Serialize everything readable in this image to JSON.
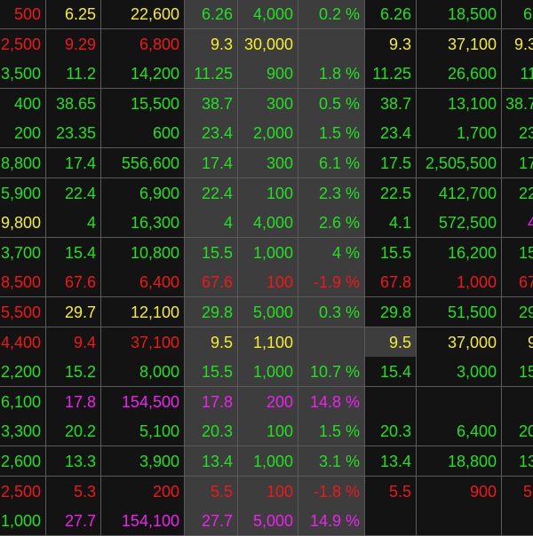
{
  "board": {
    "columns": [
      "partial-vol",
      "price-2",
      "vol-2",
      "match-price",
      "match-vol",
      "change-pct",
      "offer-price-1",
      "offer-vol-1",
      "offer-price-2"
    ],
    "rows": [
      {
        "cells": [
          {
            "v": "500",
            "c": "r"
          },
          {
            "v": "6.25",
            "c": "y"
          },
          {
            "v": "22,600",
            "c": "y"
          },
          {
            "v": "6.26",
            "c": "g"
          },
          {
            "v": "4,000",
            "c": "g"
          },
          {
            "v": "0.2 %",
            "c": "g"
          },
          {
            "v": "6.26",
            "c": "g"
          },
          {
            "v": "18,500",
            "c": "g"
          },
          {
            "v": "6.",
            "c": "g"
          }
        ]
      },
      {
        "cells": [
          {
            "v": "2,500",
            "c": "r"
          },
          {
            "v": "9.29",
            "c": "r"
          },
          {
            "v": "6,800",
            "c": "r"
          },
          {
            "v": "9.3",
            "c": "y"
          },
          {
            "v": "30,000",
            "c": "y"
          },
          {
            "v": "",
            "c": "y"
          },
          {
            "v": "9.3",
            "c": "y"
          },
          {
            "v": "37,100",
            "c": "y"
          },
          {
            "v": "9.3",
            "c": "y"
          }
        ]
      },
      {
        "cells": [
          {
            "v": "3,500",
            "c": "g"
          },
          {
            "v": "11.2",
            "c": "g"
          },
          {
            "v": "14,200",
            "c": "g"
          },
          {
            "v": "11.25",
            "c": "g"
          },
          {
            "v": "900",
            "c": "g"
          },
          {
            "v": "1.8 %",
            "c": "g"
          },
          {
            "v": "11.25",
            "c": "g"
          },
          {
            "v": "26,600",
            "c": "g"
          },
          {
            "v": "11",
            "c": "g"
          }
        ]
      },
      {
        "cells": [
          {
            "v": "400",
            "c": "g"
          },
          {
            "v": "38.65",
            "c": "g"
          },
          {
            "v": "15,500",
            "c": "g"
          },
          {
            "v": "38.7",
            "c": "g"
          },
          {
            "v": "300",
            "c": "g"
          },
          {
            "v": "0.5 %",
            "c": "g"
          },
          {
            "v": "38.7",
            "c": "g"
          },
          {
            "v": "13,100",
            "c": "g"
          },
          {
            "v": "38.7",
            "c": "g"
          }
        ]
      },
      {
        "cells": [
          {
            "v": "200",
            "c": "g"
          },
          {
            "v": "23.35",
            "c": "g"
          },
          {
            "v": "600",
            "c": "g"
          },
          {
            "v": "23.4",
            "c": "g"
          },
          {
            "v": "2,000",
            "c": "g"
          },
          {
            "v": "1.5 %",
            "c": "g"
          },
          {
            "v": "23.4",
            "c": "g"
          },
          {
            "v": "1,700",
            "c": "g"
          },
          {
            "v": "23",
            "c": "g"
          }
        ]
      },
      {
        "cells": [
          {
            "v": "8,800",
            "c": "g"
          },
          {
            "v": "17.4",
            "c": "g"
          },
          {
            "v": "556,600",
            "c": "g"
          },
          {
            "v": "17.4",
            "c": "g"
          },
          {
            "v": "300",
            "c": "g"
          },
          {
            "v": "6.1 %",
            "c": "g"
          },
          {
            "v": "17.5",
            "c": "g"
          },
          {
            "v": "2,505,500",
            "c": "g"
          },
          {
            "v": "17",
            "c": "g"
          }
        ]
      },
      {
        "cells": [
          {
            "v": "5,900",
            "c": "g"
          },
          {
            "v": "22.4",
            "c": "g"
          },
          {
            "v": "6,900",
            "c": "g"
          },
          {
            "v": "22.4",
            "c": "g"
          },
          {
            "v": "100",
            "c": "g"
          },
          {
            "v": "2.3 %",
            "c": "g"
          },
          {
            "v": "22.5",
            "c": "g"
          },
          {
            "v": "412,700",
            "c": "g"
          },
          {
            "v": "22",
            "c": "g"
          }
        ]
      },
      {
        "cells": [
          {
            "v": "9,800",
            "c": "y"
          },
          {
            "v": "4",
            "c": "g"
          },
          {
            "v": "16,300",
            "c": "g"
          },
          {
            "v": "4",
            "c": "g"
          },
          {
            "v": "4,000",
            "c": "g"
          },
          {
            "v": "2.6 %",
            "c": "g"
          },
          {
            "v": "4.1",
            "c": "g"
          },
          {
            "v": "572,500",
            "c": "g"
          },
          {
            "v": "4",
            "c": "p"
          }
        ]
      },
      {
        "cells": [
          {
            "v": "3,700",
            "c": "g"
          },
          {
            "v": "15.4",
            "c": "g"
          },
          {
            "v": "10,800",
            "c": "g"
          },
          {
            "v": "15.5",
            "c": "g"
          },
          {
            "v": "1,000",
            "c": "g"
          },
          {
            "v": "4 %",
            "c": "g"
          },
          {
            "v": "15.5",
            "c": "g"
          },
          {
            "v": "16,200",
            "c": "g"
          },
          {
            "v": "15",
            "c": "g"
          }
        ]
      },
      {
        "cells": [
          {
            "v": "8,500",
            "c": "r"
          },
          {
            "v": "67.6",
            "c": "r"
          },
          {
            "v": "6,400",
            "c": "r"
          },
          {
            "v": "67.6",
            "c": "r"
          },
          {
            "v": "100",
            "c": "r"
          },
          {
            "v": "-1.9 %",
            "c": "r"
          },
          {
            "v": "67.8",
            "c": "r"
          },
          {
            "v": "1,000",
            "c": "r"
          },
          {
            "v": "67",
            "c": "r"
          }
        ]
      },
      {
        "cells": [
          {
            "v": "5,500",
            "c": "r"
          },
          {
            "v": "29.7",
            "c": "y"
          },
          {
            "v": "12,100",
            "c": "y"
          },
          {
            "v": "29.8",
            "c": "g"
          },
          {
            "v": "5,000",
            "c": "g"
          },
          {
            "v": "0.3 %",
            "c": "g"
          },
          {
            "v": "29.8",
            "c": "g"
          },
          {
            "v": "51,500",
            "c": "g"
          },
          {
            "v": "29",
            "c": "g"
          }
        ]
      },
      {
        "cells": [
          {
            "v": "4,400",
            "c": "r"
          },
          {
            "v": "9.4",
            "c": "r"
          },
          {
            "v": "37,100",
            "c": "r"
          },
          {
            "v": "9.5",
            "c": "y"
          },
          {
            "v": "1,100",
            "c": "y"
          },
          {
            "v": "",
            "c": "y"
          },
          {
            "v": "9.5",
            "c": "y",
            "hl": true
          },
          {
            "v": "37,000",
            "c": "y"
          },
          {
            "v": "9",
            "c": "y"
          }
        ]
      },
      {
        "cells": [
          {
            "v": "2,200",
            "c": "g"
          },
          {
            "v": "15.2",
            "c": "g"
          },
          {
            "v": "8,000",
            "c": "g"
          },
          {
            "v": "15.5",
            "c": "g"
          },
          {
            "v": "1,000",
            "c": "g"
          },
          {
            "v": "10.7 %",
            "c": "g"
          },
          {
            "v": "15.4",
            "c": "g"
          },
          {
            "v": "3,000",
            "c": "g"
          },
          {
            "v": "15",
            "c": "g"
          }
        ]
      },
      {
        "cells": [
          {
            "v": "6,100",
            "c": "g"
          },
          {
            "v": "17.8",
            "c": "p"
          },
          {
            "v": "154,500",
            "c": "p"
          },
          {
            "v": "17.8",
            "c": "p"
          },
          {
            "v": "200",
            "c": "p"
          },
          {
            "v": "14.8 %",
            "c": "p"
          },
          {
            "v": "",
            "c": "p"
          },
          {
            "v": "",
            "c": "p"
          },
          {
            "v": "",
            "c": "p"
          }
        ]
      },
      {
        "cells": [
          {
            "v": "3,300",
            "c": "g"
          },
          {
            "v": "20.2",
            "c": "g"
          },
          {
            "v": "5,100",
            "c": "g"
          },
          {
            "v": "20.3",
            "c": "g"
          },
          {
            "v": "100",
            "c": "g"
          },
          {
            "v": "1.5 %",
            "c": "g"
          },
          {
            "v": "20.3",
            "c": "g"
          },
          {
            "v": "6,400",
            "c": "g"
          },
          {
            "v": "20",
            "c": "g"
          }
        ]
      },
      {
        "cells": [
          {
            "v": "2,600",
            "c": "g"
          },
          {
            "v": "13.3",
            "c": "g"
          },
          {
            "v": "3,900",
            "c": "g"
          },
          {
            "v": "13.4",
            "c": "g"
          },
          {
            "v": "1,000",
            "c": "g"
          },
          {
            "v": "3.1 %",
            "c": "g"
          },
          {
            "v": "13.4",
            "c": "g"
          },
          {
            "v": "18,800",
            "c": "g"
          },
          {
            "v": "13",
            "c": "g"
          }
        ]
      },
      {
        "cells": [
          {
            "v": "2,500",
            "c": "r"
          },
          {
            "v": "5.3",
            "c": "r"
          },
          {
            "v": "200",
            "c": "r"
          },
          {
            "v": "5.5",
            "c": "r"
          },
          {
            "v": "100",
            "c": "r"
          },
          {
            "v": "-1.8 %",
            "c": "r"
          },
          {
            "v": "5.5",
            "c": "r"
          },
          {
            "v": "900",
            "c": "r"
          },
          {
            "v": "5.",
            "c": "r"
          }
        ]
      },
      {
        "cells": [
          {
            "v": "1,000",
            "c": "g"
          },
          {
            "v": "27.7",
            "c": "p"
          },
          {
            "v": "154,100",
            "c": "p"
          },
          {
            "v": "27.7",
            "c": "p"
          },
          {
            "v": "5,000",
            "c": "p"
          },
          {
            "v": "14.9 %",
            "c": "p"
          },
          {
            "v": "",
            "c": "p"
          },
          {
            "v": "",
            "c": "p"
          },
          {
            "v": "",
            "c": "p"
          }
        ]
      }
    ]
  },
  "colors": {
    "up": "#22e022",
    "down": "#f01818",
    "reference": "#f5ee2c",
    "ceiling": "#ee22ee",
    "background": "#131313",
    "highlight": "#3d3d3d"
  }
}
